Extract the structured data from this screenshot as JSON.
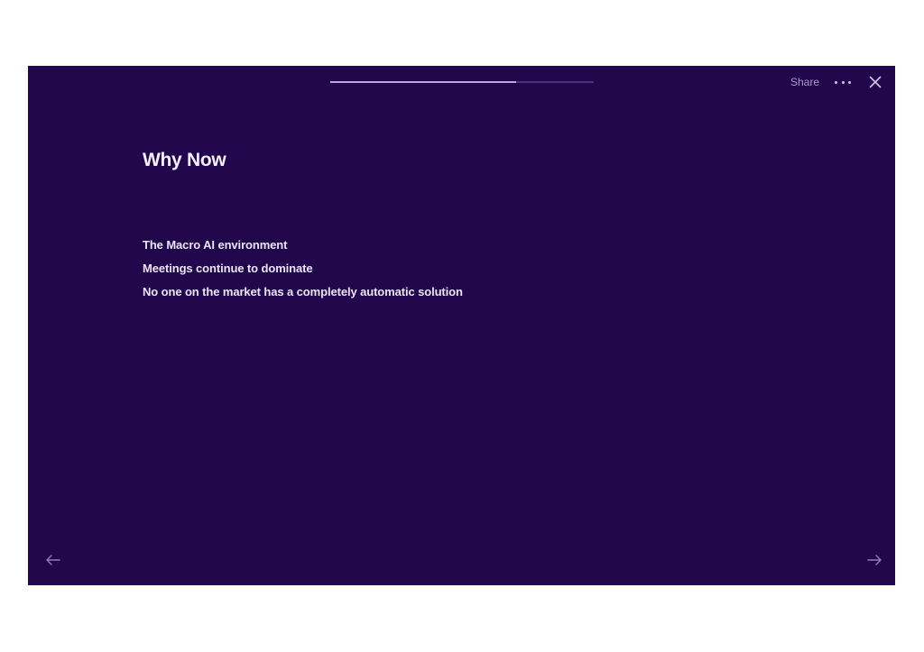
{
  "header": {
    "progress_fraction": 0.705,
    "share_label": "Share",
    "more_icon": "ellipsis-icon",
    "close_icon": "close-icon"
  },
  "slide": {
    "title": "Why Now",
    "bullets": [
      "The Macro AI environment",
      "Meetings continue to dominate",
      "No one on the market has a completely automatic solution"
    ]
  },
  "navigation": {
    "prev_icon": "arrow-left-icon",
    "next_icon": "arrow-right-icon"
  },
  "colors": {
    "background": "#22074d",
    "accent": "#b8a8e0"
  }
}
